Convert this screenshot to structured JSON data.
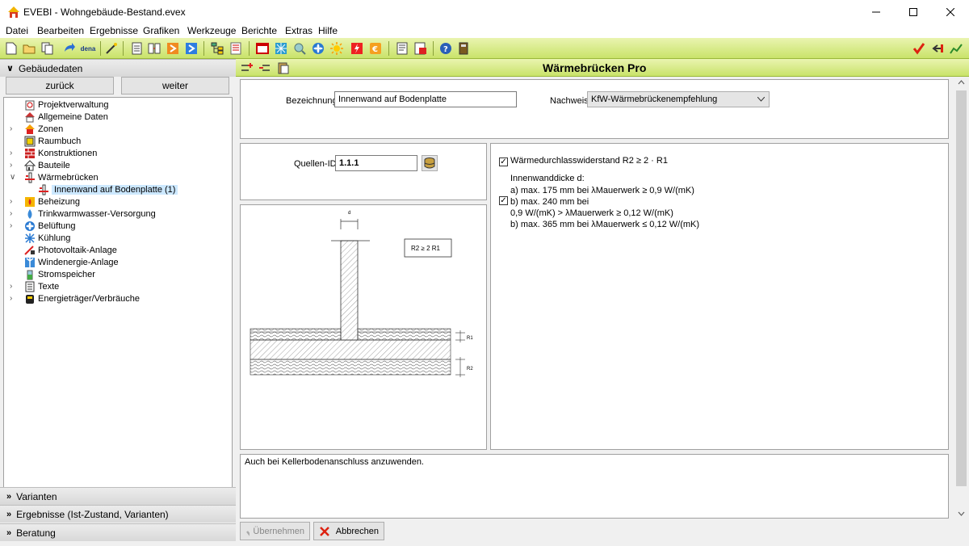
{
  "window": {
    "title": "EVEBI - Wohngebäude-Bestand.evex"
  },
  "menu": [
    "Datei",
    "Bearbeiten",
    "Ergebnisse",
    "Grafiken",
    "Werkzeuge",
    "Berichte",
    "Extras",
    "Hilfe"
  ],
  "toolbar": {
    "dena_label": "dena"
  },
  "left": {
    "section_title": "Gebäudedaten",
    "back_label": "zurück",
    "next_label": "weiter",
    "tree": [
      {
        "label": "Projektverwaltung",
        "icon": "project-icon"
      },
      {
        "label": "Allgemeine Daten",
        "icon": "house-data-icon"
      },
      {
        "label": "Zonen",
        "icon": "zones-icon"
      },
      {
        "label": "Raumbuch",
        "icon": "room-book-icon"
      },
      {
        "label": "Konstruktionen",
        "icon": "constructions-icon"
      },
      {
        "label": "Bauteile",
        "icon": "components-icon"
      },
      {
        "label": "Wärmebrücken",
        "icon": "thermal-bridge-icon"
      },
      {
        "label": "Innenwand auf Bodenplatte (1)",
        "icon": "thermal-bridge-item-icon"
      },
      {
        "label": "Beheizung",
        "icon": "heating-icon"
      },
      {
        "label": "Trinkwarmwasser-Versorgung",
        "icon": "hot-water-icon"
      },
      {
        "label": "Belüftung",
        "icon": "ventilation-icon"
      },
      {
        "label": "Kühlung",
        "icon": "cooling-icon"
      },
      {
        "label": "Photovoltaik-Anlage",
        "icon": "photovoltaic-icon"
      },
      {
        "label": "Windenergie-Anlage",
        "icon": "wind-energy-icon"
      },
      {
        "label": "Stromspeicher",
        "icon": "battery-icon"
      },
      {
        "label": "Texte",
        "icon": "texts-icon"
      },
      {
        "label": "Energieträger/Verbräuche",
        "icon": "energy-carrier-icon"
      }
    ],
    "sections": [
      "Varianten",
      "Ergebnisse (Ist-Zustand, Varianten)",
      "Beratung"
    ]
  },
  "main": {
    "title": "Wärmebrücken Pro",
    "bezeichnung_label": "Bezeichnung",
    "bezeichnung_value": "Innenwand auf Bodenplatte",
    "nachweis_label": "Nachweis",
    "nachweis_value": "KfW-Wärmebrückenempfehlung",
    "quellen_label": "Quellen-ID",
    "quellen_value": "1.1.1",
    "check1_label": "Wärmedurchlasswiderstand R2 ≥ 2 · R1",
    "check1_checked": true,
    "text_line1": "Innenwanddicke d:",
    "text_line2": "a) max. 175 mm bei λMauerwerk ≥ 0,9 W/(mK)",
    "check2_checked": true,
    "text_line3": "b) max. 240 mm bei",
    "text_line4": "0,9 W/(mK) > λMauerwerk ≥ 0,12 W/(mK)",
    "text_line5": "b) max. 365 mm bei λMauerwerk ≤ 0,12 W/(mK)",
    "diagram_d": "d",
    "diagram_r_label": "R2 ≥ 2 R1",
    "diagram_r1": "R1",
    "diagram_r2": "R2",
    "note": "Auch bei Kellerbodenanschluss anzuwenden.",
    "apply_label": "Übernehmen",
    "cancel_label": "Abbrechen"
  }
}
